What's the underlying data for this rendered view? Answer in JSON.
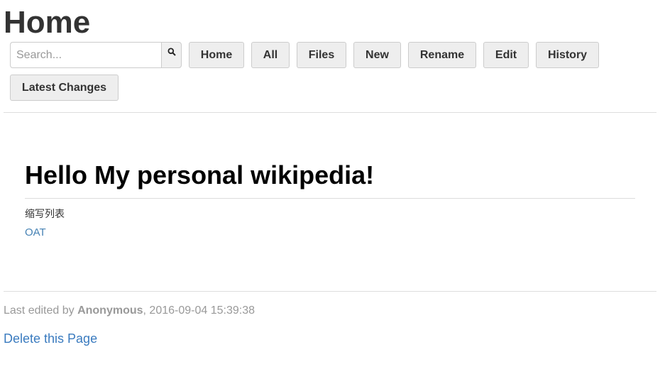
{
  "header": {
    "title": "Home"
  },
  "search": {
    "placeholder": "Search..."
  },
  "nav": {
    "home": "Home",
    "all": "All",
    "files": "Files",
    "new": "New",
    "rename": "Rename",
    "edit": "Edit",
    "history": "History",
    "latest_changes": "Latest Changes"
  },
  "content": {
    "heading": "Hello My personal wikipedia!",
    "abbr_list_label": "缩写列表",
    "link_oat": "OAT"
  },
  "footer": {
    "last_edited_prefix": "Last edited by ",
    "author": "Anonymous",
    "timestamp": ", 2016-09-04 15:39:38",
    "delete_link": "Delete this Page"
  },
  "colors": {
    "link": "#3a7bbf",
    "button_bg": "#eeeeee",
    "muted_text": "#999999"
  }
}
